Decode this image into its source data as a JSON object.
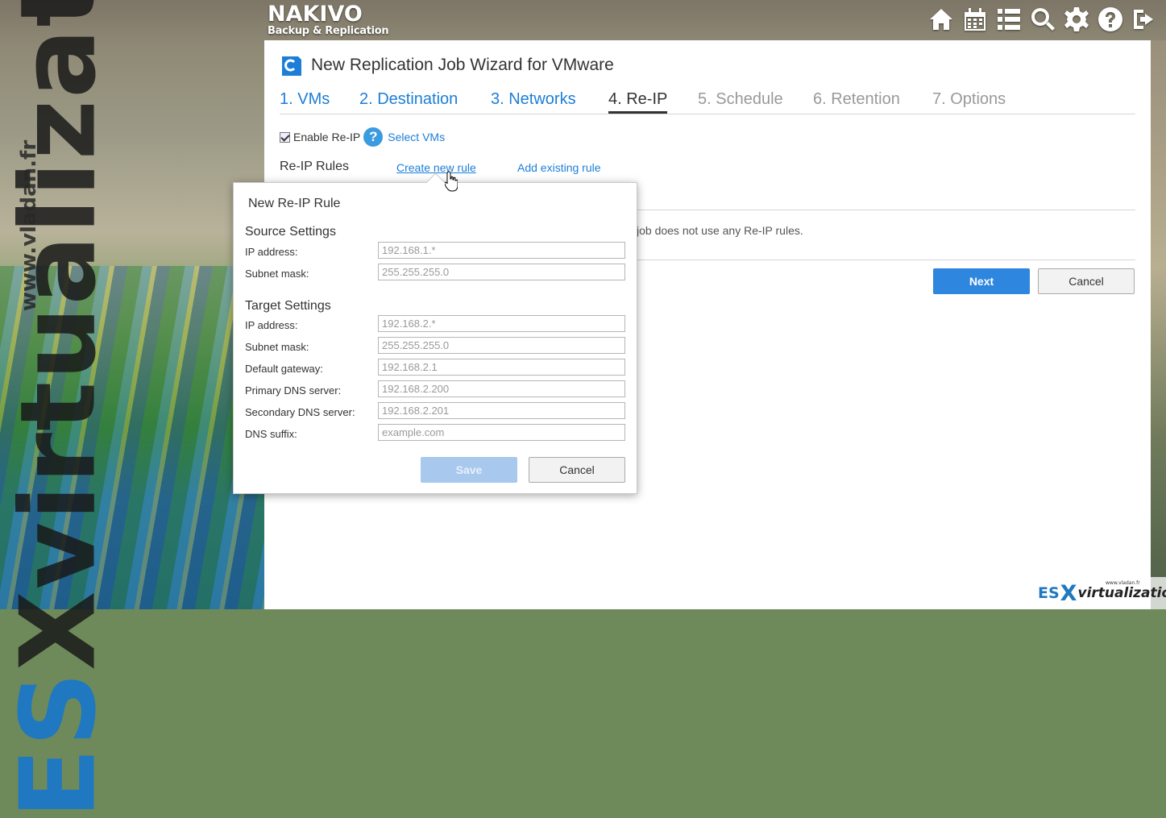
{
  "watermark": {
    "vertical_text_es": "ES",
    "vertical_text_rest": "Xvirtualization",
    "vertical_url": "www.vladan.fr"
  },
  "app": {
    "logo_line1": "NAKIVO",
    "logo_line2": "Backup & Replication"
  },
  "topnav": {
    "icons": [
      "home-icon",
      "calendar-icon",
      "list-icon",
      "search-icon",
      "gear-icon",
      "help-icon",
      "logout-icon"
    ]
  },
  "wizard": {
    "title": "New Replication Job Wizard for VMware",
    "steps": [
      {
        "label": "1. VMs",
        "state": "done"
      },
      {
        "label": "2. Destination",
        "state": "done"
      },
      {
        "label": "3. Networks",
        "state": "done"
      },
      {
        "label": "4. Re-IP",
        "state": "current"
      },
      {
        "label": "5. Schedule",
        "state": "pending"
      },
      {
        "label": "6. Retention",
        "state": "pending"
      },
      {
        "label": "7. Options",
        "state": "pending"
      }
    ],
    "enable_reip_label": "Enable Re-IP",
    "enable_reip_checked": true,
    "select_vms_link": "Select VMs",
    "rules_label": "Re-IP Rules",
    "create_rule_link": "Create new rule",
    "add_rule_link": "Add existing rule",
    "no_rules_text": "job does not use any Re-IP rules.",
    "next_label": "Next",
    "cancel_label": "Cancel"
  },
  "dialog": {
    "title": "New Re-IP Rule",
    "source_title": "Source Settings",
    "source_fields": [
      {
        "label": "IP address:",
        "value": "192.168.1.*"
      },
      {
        "label": "Subnet mask:",
        "value": "255.255.255.0"
      }
    ],
    "target_title": "Target Settings",
    "target_fields": [
      {
        "label": "IP address:",
        "value": "192.168.2.*"
      },
      {
        "label": "Subnet mask:",
        "value": " 255.255.255.0"
      },
      {
        "label": "Default gateway:",
        "value": "192.168.2.1"
      },
      {
        "label": "Primary DNS server:",
        "value": "192.168.2.200"
      },
      {
        "label": "Secondary DNS server:",
        "value": "192.168.2.201"
      },
      {
        "label": "DNS suffix:",
        "value": "example.com"
      }
    ],
    "save_label": "Save",
    "cancel_label": "Cancel"
  },
  "badge": {
    "es": "ES",
    "x": "X",
    "virt": "virtualization",
    "small": "www.vladan.fr"
  },
  "colors": {
    "accent": "#1c7ed6",
    "primary_button": "#2e86de",
    "disabled_button": "#a8c8ee"
  }
}
